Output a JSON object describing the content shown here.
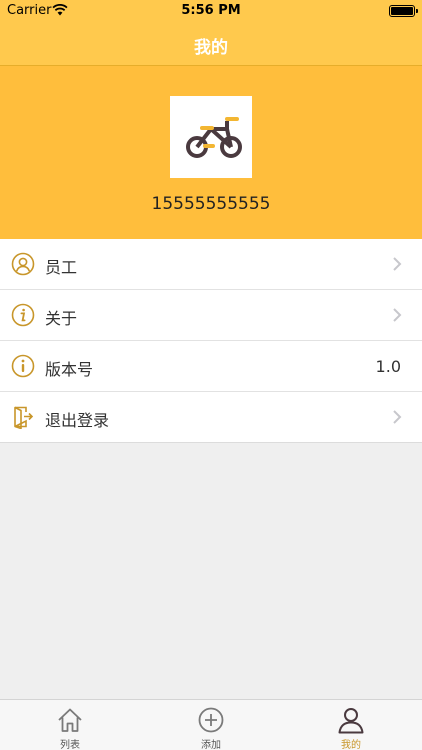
{
  "status_bar": {
    "carrier": "Carrier",
    "time": "5:56 PM"
  },
  "nav": {
    "title": "我的"
  },
  "profile": {
    "phone": "15555555555",
    "avatar_icon": "bicycle-icon"
  },
  "menu": {
    "items": [
      {
        "label": "员工",
        "icon": "user-circle-icon"
      },
      {
        "label": "关于",
        "icon": "info-icon"
      },
      {
        "label": "版本号",
        "icon": "info-icon",
        "value": "1.0"
      },
      {
        "label": "退出登录",
        "icon": "logout-door-icon"
      }
    ]
  },
  "tabs": [
    {
      "label": "列表",
      "icon": "home-icon"
    },
    {
      "label": "添加",
      "icon": "plus-circle-icon"
    },
    {
      "label": "我的",
      "icon": "person-icon",
      "active": true
    }
  ],
  "colors": {
    "accent": "#ffbe3c",
    "icon_gold": "#c8962a",
    "active_tab": "#c8962a"
  }
}
